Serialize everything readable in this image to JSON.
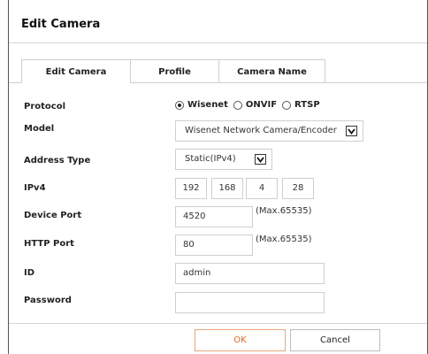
{
  "dialog": {
    "title": "Edit Camera"
  },
  "tabs": [
    {
      "label": "Edit Camera",
      "active": true
    },
    {
      "label": "Profile",
      "active": false
    },
    {
      "label": "Camera Name",
      "active": false
    }
  ],
  "form": {
    "protocol": {
      "label": "Protocol",
      "options": [
        "Wisenet",
        "ONVIF",
        "RTSP"
      ],
      "selected": "Wisenet"
    },
    "model": {
      "label": "Model",
      "value": "Wisenet Network Camera/Encoder"
    },
    "address_type": {
      "label": "Address Type",
      "value": "Static(IPv4)"
    },
    "ipv4": {
      "label": "IPv4",
      "octets": [
        "192",
        "168",
        "4",
        "28"
      ]
    },
    "device_port": {
      "label": "Device Port",
      "value": "4520",
      "hint": "(Max.65535)"
    },
    "http_port": {
      "label": "HTTP Port",
      "value": "80",
      "hint": "(Max.65535)"
    },
    "id": {
      "label": "ID",
      "value": "admin"
    },
    "password": {
      "label": "Password",
      "value": ""
    }
  },
  "buttons": {
    "ok": "OK",
    "cancel": "Cancel"
  },
  "colors": {
    "ok_text": "#e0641e",
    "border": "#cfcfcf",
    "frame": "#555555"
  },
  "icons": {
    "select_arrow": "chevron-down-icon",
    "radio": "radio-button-icon"
  }
}
